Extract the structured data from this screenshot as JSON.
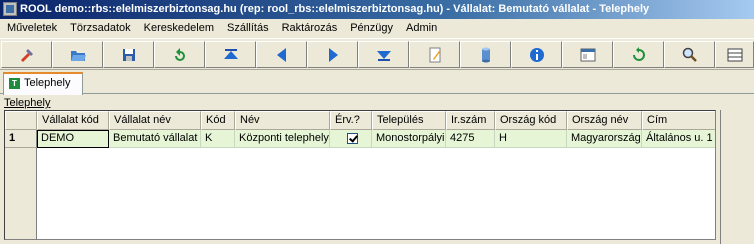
{
  "window": {
    "title": "ROOL demo::rbs::elelmiszerbiztonsag.hu (rep: rool_rbs::elelmiszerbiztonsag.hu) - Vállalat: Bemutató vállalat - Telephely"
  },
  "menu": {
    "items": [
      "Műveletek",
      "Törzsadatok",
      "Kereskedelem",
      "Szállítás",
      "Raktározás",
      "Pénzügy",
      "Admin"
    ]
  },
  "toolbar": {
    "buttons": [
      {
        "icon": "tools-icon"
      },
      {
        "icon": "open-folder-icon"
      },
      {
        "icon": "save-icon"
      },
      {
        "icon": "refresh-arrow-icon"
      },
      {
        "icon": "first-record-icon"
      },
      {
        "icon": "previous-record-icon"
      },
      {
        "icon": "next-record-icon"
      },
      {
        "icon": "last-record-icon"
      },
      {
        "icon": "edit-icon"
      },
      {
        "icon": "database-icon"
      },
      {
        "icon": "info-icon"
      },
      {
        "icon": "form-view-icon"
      },
      {
        "icon": "reload-icon"
      },
      {
        "icon": "search-icon"
      },
      {
        "icon": "grid-icon"
      }
    ]
  },
  "tabs": [
    {
      "label": "Telephely"
    }
  ],
  "group": {
    "label": "Telephely"
  },
  "grid": {
    "columns": [
      "Vállalat kód",
      "Vállalat név",
      "Kód",
      "Név",
      "Érv.?",
      "Település",
      "Ir.szám",
      "Ország kód",
      "Ország név",
      "Cím"
    ],
    "rows": [
      {
        "rownum": "1",
        "cells": [
          "DEMO",
          "Bemutató vállalat",
          "K",
          "Központi telephely",
          "",
          "Monostorpályi",
          "4275",
          "H",
          "Magyarország",
          "Általános u. 1"
        ],
        "valid_checked": true
      }
    ]
  },
  "colors": {
    "titlebar": "#0a246a",
    "row_highlight": "#e6f5d6",
    "tab_accent": "#e68b2c"
  }
}
